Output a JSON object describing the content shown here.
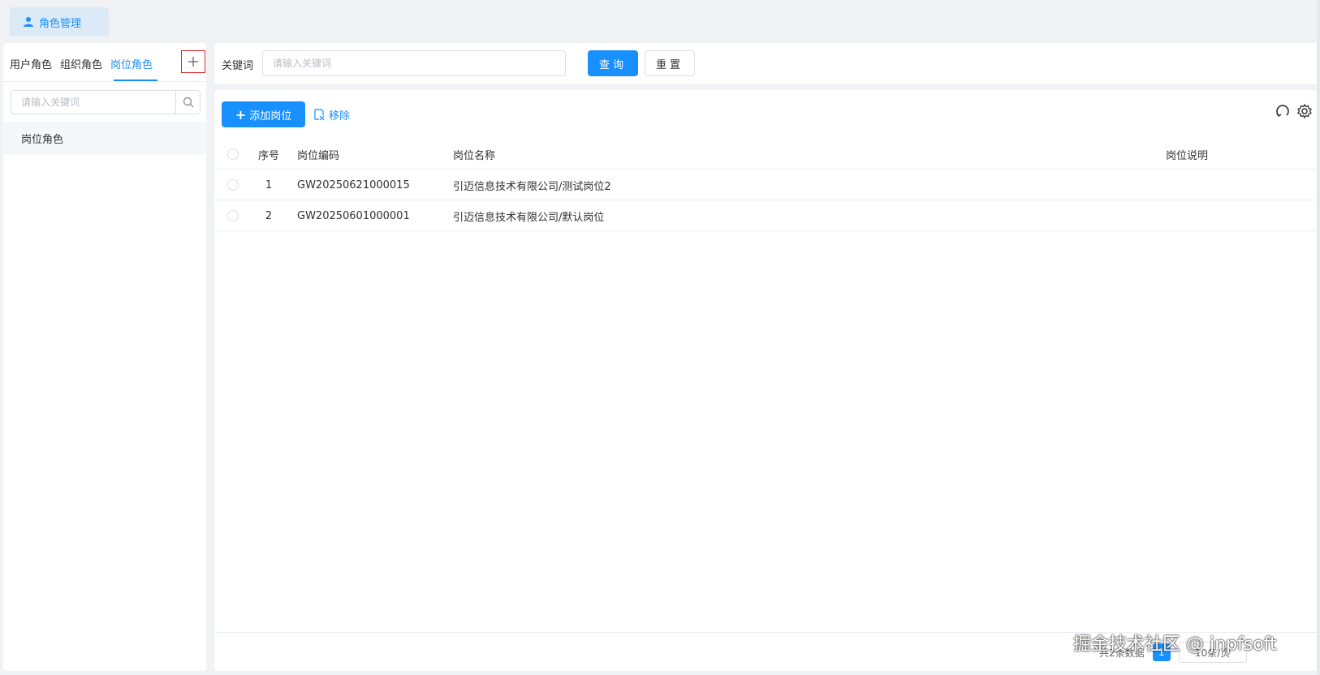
{
  "tabbar": {
    "tab_label": "角色管理",
    "tab_icon": "user-icon"
  },
  "left_panel": {
    "tabs": [
      "用户角色",
      "组织角色",
      "岗位角色"
    ],
    "active_tab": "岗位角色",
    "add_icon": "plus-icon",
    "search_placeholder": "请输入关键词",
    "tree_nodes": [
      "岗位角色"
    ]
  },
  "search_bar": {
    "keyword_label": "关键词",
    "keyword_placeholder": "请输入关键词",
    "query_label": "查询",
    "reset_label": "重置"
  },
  "toolbar": {
    "add_label": "添加岗位",
    "remove_label": "移除",
    "refresh_icon": "refresh-icon",
    "settings_icon": "gear-icon"
  },
  "table": {
    "columns": [
      "序号",
      "岗位编码",
      "岗位名称",
      "岗位说明"
    ],
    "rows": [
      {
        "index": "1",
        "code": "GW20250621000015",
        "name": "引迈信息技术有限公司/测试岗位2",
        "desc": ""
      },
      {
        "index": "2",
        "code": "GW20250601000001",
        "name": "引迈信息技术有限公司/默认岗位",
        "desc": ""
      }
    ]
  },
  "pagination": {
    "total_label": "共2条数据",
    "current_page": "1",
    "page_size_label": "10条/页"
  },
  "watermark": "掘金技术社区 @ jnpfsoft",
  "colors": {
    "primary": "#1890ff",
    "highlight_border": "#e0252a"
  }
}
